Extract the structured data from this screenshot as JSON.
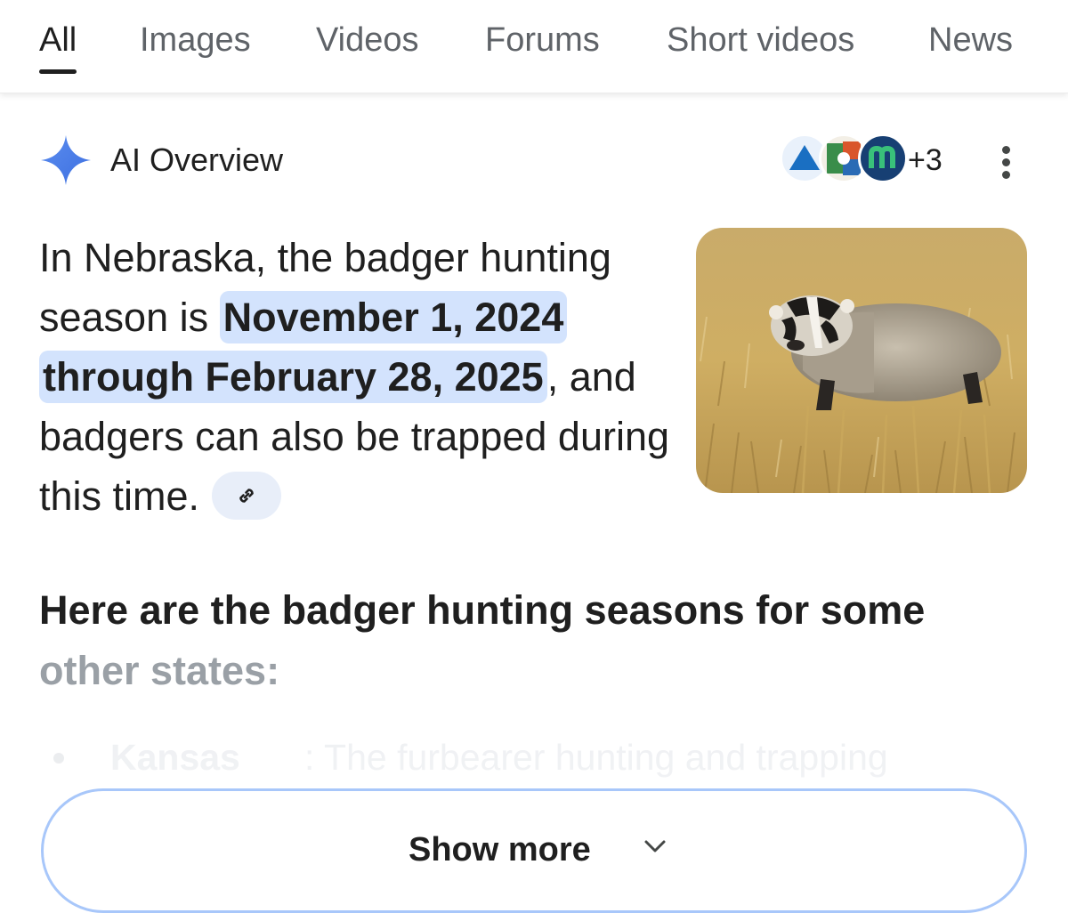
{
  "tabs": [
    {
      "label": "All",
      "active": true
    },
    {
      "label": "Images",
      "active": false
    },
    {
      "label": "Videos",
      "active": false
    },
    {
      "label": "Forums",
      "active": false
    },
    {
      "label": "Short videos",
      "active": false
    },
    {
      "label": "News",
      "active": false
    }
  ],
  "ai_overview": {
    "title": "AI Overview",
    "icon": "sparkle-icon",
    "sources_extra_count": "+3",
    "paragraph": {
      "before": "In Nebraska, the badger hunting season is ",
      "highlight": "November 1, 2024 through February 28, 2025",
      "after": ", and badgers can also be trapped during this time."
    },
    "link_icon": "link-icon",
    "image": "badger-photo"
  },
  "subheading": {
    "line1": "Here are the badger hunting seasons for some",
    "line2": "other states:"
  },
  "list_items": [
    {
      "state": "Kansas",
      "text": ": The furbearer hunting and trapping"
    }
  ],
  "show_more": {
    "label": "Show more",
    "icon": "chevron-down-icon"
  },
  "colors": {
    "highlight": "#d3e3fd",
    "accent_blue": "#4285f4",
    "show_more_border": "#a8c7fa"
  }
}
